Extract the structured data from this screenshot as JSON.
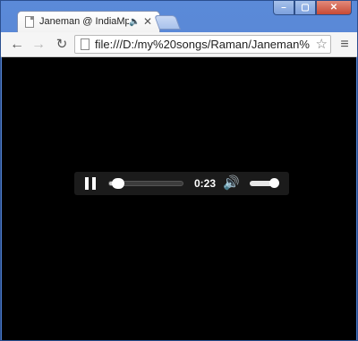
{
  "window": {
    "controls": {
      "minimize": "–",
      "maximize": "▢",
      "close": "✕"
    }
  },
  "tab": {
    "title": "Janeman @ IndiaMp3.C",
    "icon": "document-icon",
    "audio_icon": "🔈",
    "close_label": "✕"
  },
  "toolbar": {
    "back": "←",
    "forward": "→",
    "reload": "↻",
    "url": "file:///D:/my%20songs/Raman/Janeman%",
    "star": "☆",
    "menu": "≡"
  },
  "player": {
    "time": "0:23",
    "seek_fraction": 0.12,
    "volume_fraction": 0.9,
    "volume_icon": "🔊"
  }
}
